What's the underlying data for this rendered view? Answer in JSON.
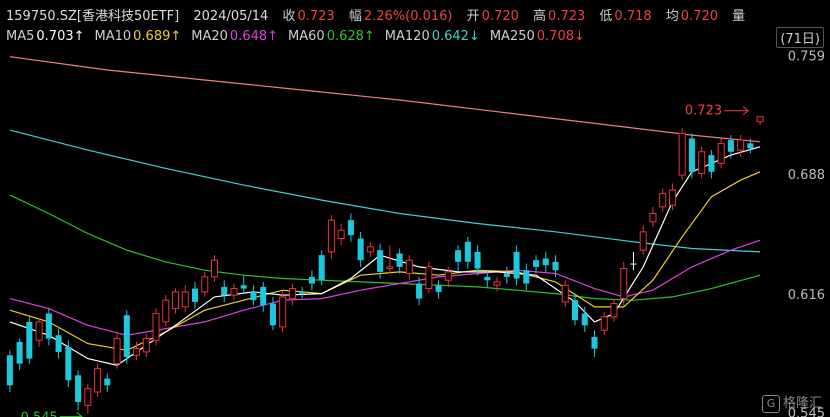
{
  "header": {
    "title": "159750.SZ[香港科技50ETF]",
    "date": "2024/05/14",
    "close_label": "收",
    "close": "0.723",
    "change_label": "幅",
    "change": "2.26%(0.016)",
    "open_label": "开",
    "open": "0.720",
    "high_label": "高",
    "high": "0.723",
    "low_label": "低",
    "low": "0.718",
    "avg_label": "均",
    "avg": "0.720",
    "volume_label": "量",
    "period": "(71日)"
  },
  "ma_legend": [
    {
      "label": "MA5",
      "value": "0.703↑",
      "color": "#ffffff"
    },
    {
      "label": "MA10",
      "value": "0.689↑",
      "color": "#f0d020"
    },
    {
      "label": "MA20",
      "value": "0.648↑",
      "color": "#e040e0"
    },
    {
      "label": "MA60",
      "value": "0.628↑",
      "color": "#30c030"
    },
    {
      "label": "MA120",
      "value": "0.642↓",
      "color": "#40d0d0"
    },
    {
      "label": "MA250",
      "value": "0.708↓",
      "color": "#f04040"
    }
  ],
  "colors": {
    "up": "#e8323c",
    "down": "#1ec8dc",
    "ma5": "#ffffff",
    "ma10": "#f0d020",
    "ma20": "#e040e0",
    "ma60": "#30c030",
    "ma120": "#40d0d0",
    "ma250": "#f08080",
    "hi_label": "#f04040",
    "lo_label": "#30c030",
    "axis": "#bbbbbb"
  },
  "chart_data": {
    "type": "candlestick",
    "yticks": [
      "0.759",
      "0.688",
      "0.616",
      "0.545"
    ],
    "ylim": [
      0.543,
      0.763
    ],
    "high_label": "0.723",
    "low_label": "0.545",
    "candles": [
      [
        0.58,
        0.562,
        0.583,
        0.558
      ],
      [
        0.588,
        0.575,
        0.59,
        0.571
      ],
      [
        0.6,
        0.578,
        0.603,
        0.575
      ],
      [
        0.589,
        0.6,
        0.602,
        0.585
      ],
      [
        0.605,
        0.59,
        0.608,
        0.586
      ],
      [
        0.592,
        0.582,
        0.596,
        0.578
      ],
      [
        0.585,
        0.565,
        0.589,
        0.561
      ],
      [
        0.568,
        0.552,
        0.571,
        0.547
      ],
      [
        0.55,
        0.56,
        0.563,
        0.545
      ],
      [
        0.558,
        0.572,
        0.575,
        0.555
      ],
      [
        0.566,
        0.562,
        0.569,
        0.558
      ],
      [
        0.575,
        0.59,
        0.593,
        0.572
      ],
      [
        0.604,
        0.579,
        0.607,
        0.575
      ],
      [
        0.58,
        0.584,
        0.588,
        0.577
      ],
      [
        0.582,
        0.59,
        0.593,
        0.579
      ],
      [
        0.589,
        0.605,
        0.608,
        0.586
      ],
      [
        0.6,
        0.613,
        0.616,
        0.597
      ],
      [
        0.608,
        0.618,
        0.62,
        0.605
      ],
      [
        0.609,
        0.618,
        0.622,
        0.606
      ],
      [
        0.62,
        0.612,
        0.624,
        0.608
      ],
      [
        0.618,
        0.627,
        0.63,
        0.615
      ],
      [
        0.627,
        0.637,
        0.64,
        0.624
      ],
      [
        0.621,
        0.616,
        0.625,
        0.612
      ],
      [
        0.616,
        0.62,
        0.623,
        0.613
      ],
      [
        0.622,
        0.62,
        0.628,
        0.618
      ],
      [
        0.618,
        0.613,
        0.622,
        0.61
      ],
      [
        0.621,
        0.61,
        0.624,
        0.606
      ],
      [
        0.611,
        0.598,
        0.615,
        0.595
      ],
      [
        0.597,
        0.615,
        0.619,
        0.594
      ],
      [
        0.614,
        0.62,
        0.623,
        0.61
      ],
      [
        0.618,
        0.617,
        0.621,
        0.614
      ],
      [
        0.627,
        0.623,
        0.631,
        0.619
      ],
      [
        0.64,
        0.625,
        0.643,
        0.622
      ],
      [
        0.642,
        0.661,
        0.664,
        0.638
      ],
      [
        0.65,
        0.655,
        0.659,
        0.646
      ],
      [
        0.661,
        0.652,
        0.665,
        0.648
      ],
      [
        0.65,
        0.637,
        0.654,
        0.633
      ],
      [
        0.642,
        0.645,
        0.648,
        0.639
      ],
      [
        0.643,
        0.63,
        0.647,
        0.626
      ],
      [
        0.632,
        0.633,
        0.646,
        0.629
      ],
      [
        0.641,
        0.633,
        0.644,
        0.629
      ],
      [
        0.629,
        0.637,
        0.64,
        0.625
      ],
      [
        0.623,
        0.614,
        0.627,
        0.61
      ],
      [
        0.62,
        0.633,
        0.636,
        0.617
      ],
      [
        0.622,
        0.618,
        0.625,
        0.614
      ],
      [
        0.625,
        0.63,
        0.633,
        0.621
      ],
      [
        0.643,
        0.636,
        0.646,
        0.63
      ],
      [
        0.648,
        0.636,
        0.651,
        0.632
      ],
      [
        0.642,
        0.632,
        0.646,
        0.628
      ],
      [
        0.627,
        0.625,
        0.631,
        0.621
      ],
      [
        0.622,
        0.624,
        0.627,
        0.618
      ],
      [
        0.629,
        0.627,
        0.633,
        0.623
      ],
      [
        0.642,
        0.626,
        0.646,
        0.622
      ],
      [
        0.631,
        0.623,
        0.635,
        0.619
      ],
      [
        0.637,
        0.633,
        0.64,
        0.629
      ],
      [
        0.638,
        0.634,
        0.642,
        0.63
      ],
      [
        0.636,
        0.631,
        0.64,
        0.627
      ],
      [
        0.612,
        0.622,
        0.625,
        0.609
      ],
      [
        0.613,
        0.601,
        0.617,
        0.598
      ],
      [
        0.605,
        0.598,
        0.609,
        0.594
      ],
      [
        0.591,
        0.584,
        0.595,
        0.579
      ],
      [
        0.595,
        0.603,
        0.606,
        0.592
      ],
      [
        0.603,
        0.611,
        0.614,
        0.6
      ],
      [
        0.614,
        0.632,
        0.636,
        0.61
      ],
      [
        0.635,
        0.635,
        0.642,
        0.631
      ],
      [
        0.643,
        0.654,
        0.658,
        0.64
      ],
      [
        0.66,
        0.665,
        0.669,
        0.657
      ],
      [
        0.669,
        0.677,
        0.68,
        0.666
      ],
      [
        0.67,
        0.679,
        0.683,
        0.667
      ],
      [
        0.688,
        0.713,
        0.716,
        0.685
      ],
      [
        0.71,
        0.69,
        0.713,
        0.686
      ],
      [
        0.689,
        0.702,
        0.705,
        0.686
      ],
      [
        0.7,
        0.69,
        0.703,
        0.686
      ],
      [
        0.695,
        0.707,
        0.71,
        0.692
      ],
      [
        0.709,
        0.702,
        0.712,
        0.698
      ],
      [
        0.703,
        0.709,
        0.712,
        0.699
      ],
      [
        0.707,
        0.704,
        0.71,
        0.701
      ],
      [
        0.72,
        0.723,
        0.723,
        0.718
      ]
    ],
    "ma5": [
      [
        0,
        0.6
      ],
      [
        4,
        0.592
      ],
      [
        8,
        0.578
      ],
      [
        11,
        0.574
      ],
      [
        14,
        0.586
      ],
      [
        17,
        0.598
      ],
      [
        21,
        0.615
      ],
      [
        25,
        0.618
      ],
      [
        28,
        0.616
      ],
      [
        32,
        0.617
      ],
      [
        35,
        0.626
      ],
      [
        38,
        0.64
      ],
      [
        42,
        0.633
      ],
      [
        46,
        0.63
      ],
      [
        50,
        0.63
      ],
      [
        54,
        0.628
      ],
      [
        58,
        0.612
      ],
      [
        60,
        0.6
      ],
      [
        62,
        0.605
      ],
      [
        65,
        0.633
      ],
      [
        68,
        0.672
      ],
      [
        70,
        0.69
      ],
      [
        74,
        0.7
      ],
      [
        77,
        0.705
      ]
    ],
    "ma10": [
      [
        0,
        0.607
      ],
      [
        4,
        0.6
      ],
      [
        8,
        0.587
      ],
      [
        12,
        0.583
      ],
      [
        16,
        0.594
      ],
      [
        20,
        0.607
      ],
      [
        24,
        0.613
      ],
      [
        28,
        0.619
      ],
      [
        32,
        0.617
      ],
      [
        36,
        0.628
      ],
      [
        40,
        0.63
      ],
      [
        44,
        0.628
      ],
      [
        48,
        0.631
      ],
      [
        52,
        0.63
      ],
      [
        56,
        0.624
      ],
      [
        60,
        0.609
      ],
      [
        63,
        0.609
      ],
      [
        66,
        0.625
      ],
      [
        69,
        0.651
      ],
      [
        72,
        0.675
      ],
      [
        75,
        0.685
      ],
      [
        77,
        0.69
      ]
    ],
    "ma20": [
      [
        0,
        0.614
      ],
      [
        4,
        0.608
      ],
      [
        8,
        0.598
      ],
      [
        12,
        0.592
      ],
      [
        16,
        0.596
      ],
      [
        20,
        0.6
      ],
      [
        24,
        0.607
      ],
      [
        28,
        0.613
      ],
      [
        32,
        0.614
      ],
      [
        36,
        0.619
      ],
      [
        40,
        0.623
      ],
      [
        44,
        0.627
      ],
      [
        48,
        0.629
      ],
      [
        52,
        0.631
      ],
      [
        56,
        0.629
      ],
      [
        60,
        0.62
      ],
      [
        63,
        0.615
      ],
      [
        66,
        0.619
      ],
      [
        70,
        0.633
      ],
      [
        74,
        0.643
      ],
      [
        77,
        0.649
      ]
    ],
    "ma60": [
      [
        0,
        0.676
      ],
      [
        4,
        0.665
      ],
      [
        8,
        0.653
      ],
      [
        12,
        0.643
      ],
      [
        16,
        0.636
      ],
      [
        20,
        0.631
      ],
      [
        24,
        0.628
      ],
      [
        28,
        0.626
      ],
      [
        32,
        0.625
      ],
      [
        36,
        0.624
      ],
      [
        40,
        0.623
      ],
      [
        44,
        0.622
      ],
      [
        48,
        0.621
      ],
      [
        52,
        0.619
      ],
      [
        56,
        0.617
      ],
      [
        60,
        0.614
      ],
      [
        64,
        0.613
      ],
      [
        68,
        0.615
      ],
      [
        72,
        0.62
      ],
      [
        77,
        0.628
      ]
    ],
    "ma120": [
      [
        0,
        0.715
      ],
      [
        8,
        0.703
      ],
      [
        16,
        0.692
      ],
      [
        24,
        0.682
      ],
      [
        32,
        0.673
      ],
      [
        40,
        0.665
      ],
      [
        48,
        0.659
      ],
      [
        56,
        0.654
      ],
      [
        64,
        0.648
      ],
      [
        70,
        0.644
      ],
      [
        77,
        0.642
      ]
    ],
    "ma250": [
      [
        0,
        0.759
      ],
      [
        10,
        0.751
      ],
      [
        20,
        0.745
      ],
      [
        30,
        0.739
      ],
      [
        40,
        0.733
      ],
      [
        50,
        0.726
      ],
      [
        60,
        0.719
      ],
      [
        70,
        0.712
      ],
      [
        77,
        0.708
      ]
    ]
  },
  "watermark": {
    "glyph": "G",
    "text": "格隆汇"
  }
}
